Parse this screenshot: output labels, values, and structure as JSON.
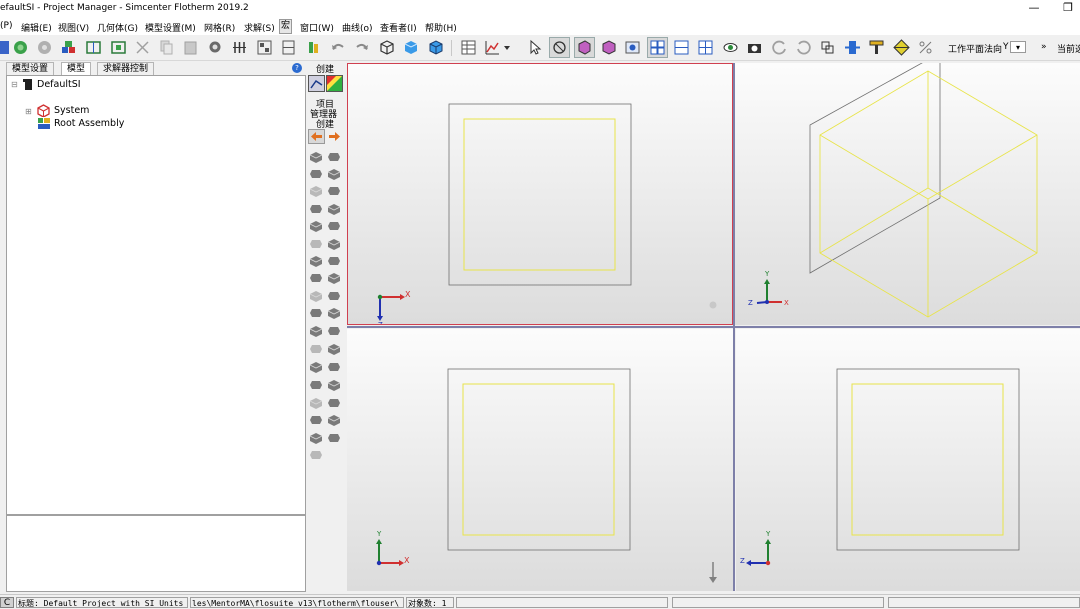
{
  "window": {
    "title": "efaultSI - Project Manager - Simcenter Flotherm 2019.2",
    "minimize": "—",
    "maximize": "❐"
  },
  "menu": {
    "items": [
      "(P)",
      "编辑(E)",
      "视图(V)",
      "几何体(G)",
      "模型设置(M)",
      "网格(R)",
      "求解(S)",
      "宏",
      "窗口(W)",
      "曲线(o)",
      "查看者(I)",
      "帮助(H)"
    ]
  },
  "toolbar": {
    "workplane_label": "工作平面法向",
    "workplane_value": "Y",
    "more_label": "»",
    "current_label": "当前选"
  },
  "left_panel": {
    "tabs": [
      "模型设置",
      "模型",
      "求解器控制"
    ],
    "help": "?",
    "tree": {
      "root": "DefaultSI",
      "children": [
        "System",
        "Root Assembly"
      ]
    }
  },
  "palette": {
    "create_label": "创建",
    "project_manager_label_1": "项目",
    "project_manager_label_2": "管理器",
    "project_manager_label_3": "创建"
  },
  "views": {
    "top_left": {
      "axis_h": "X",
      "axis_v": "Z"
    },
    "top_right": {
      "axis_v": "Y",
      "axis_h": "X",
      "axis_z": "Z"
    },
    "bottom_left": {
      "axis_v": "Y",
      "axis_h": "X"
    },
    "bottom_right": {
      "axis_v": "Y",
      "axis_h": "Z"
    }
  },
  "status": {
    "title": "标题: Default Project with SI Units",
    "path": "les\\MentorMA\\flosuite_v13\\flotherm\\flouser\\",
    "object_count": "对象数: 1"
  },
  "colors": {
    "geometry_yellow": "#e8e44a",
    "frame_gray": "#707070",
    "active_border": "#d04050",
    "divider": "#7d7fa8"
  }
}
